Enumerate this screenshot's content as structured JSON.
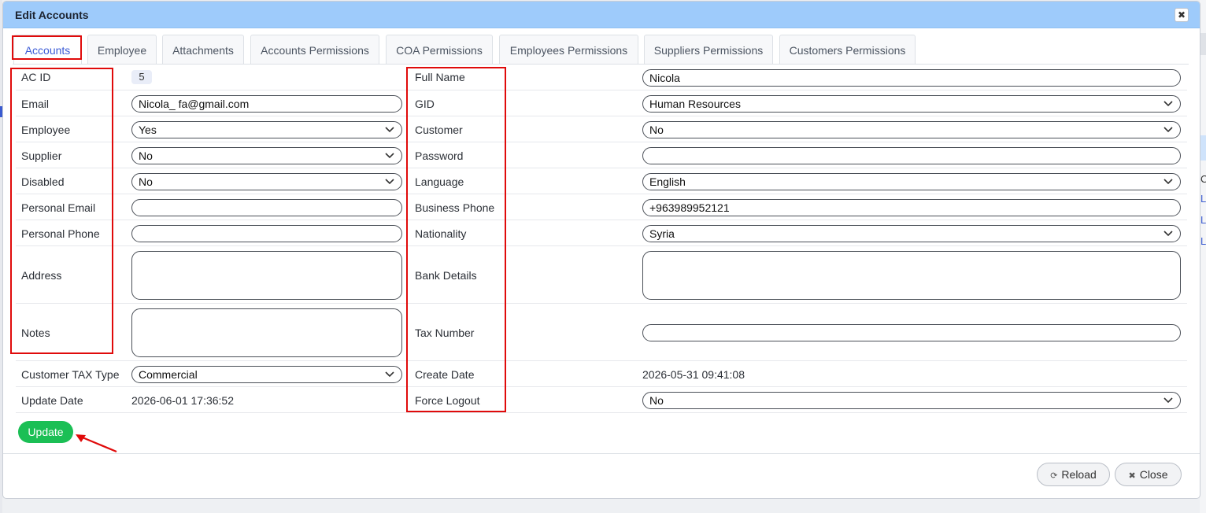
{
  "dialog": {
    "title": "Edit Accounts",
    "close_icon": "close-x-icon"
  },
  "tabs": [
    {
      "label": "Accounts",
      "active": true
    },
    {
      "label": "Employee"
    },
    {
      "label": "Attachments"
    },
    {
      "label": "Accounts Permissions"
    },
    {
      "label": "COA Permissions"
    },
    {
      "label": "Employees Permissions"
    },
    {
      "label": "Suppliers Permissions"
    },
    {
      "label": "Customers Permissions"
    }
  ],
  "form": {
    "left": {
      "ac_id": {
        "label": "AC ID",
        "value": "5"
      },
      "email": {
        "label": "Email",
        "value": "Nicola_ fa@gmail.com"
      },
      "employee": {
        "label": "Employee",
        "value": "Yes"
      },
      "supplier": {
        "label": "Supplier",
        "value": "No"
      },
      "disabled": {
        "label": "Disabled",
        "value": "No"
      },
      "personal_email": {
        "label": "Personal Email",
        "value": ""
      },
      "personal_phone": {
        "label": "Personal Phone",
        "value": ""
      },
      "address": {
        "label": "Address",
        "value": ""
      },
      "notes": {
        "label": "Notes",
        "value": ""
      },
      "customer_tax_type": {
        "label": "Customer TAX Type",
        "value": "Commercial"
      },
      "update_date": {
        "label": "Update Date",
        "value": "2026-06-01 17:36:52"
      }
    },
    "right": {
      "full_name": {
        "label": "Full Name",
        "value": "Nicola"
      },
      "gid": {
        "label": "GID",
        "value": "Human Resources"
      },
      "customer": {
        "label": "Customer",
        "value": "No"
      },
      "password": {
        "label": "Password",
        "value": ""
      },
      "language": {
        "label": "Language",
        "value": "English"
      },
      "business_phone": {
        "label": "Business Phone",
        "value": "+963989952121"
      },
      "nationality": {
        "label": "Nationality",
        "value": "Syria"
      },
      "bank_details": {
        "label": "Bank Details",
        "value": ""
      },
      "tax_number": {
        "label": "Tax Number",
        "value": ""
      },
      "create_date": {
        "label": "Create Date",
        "value": "2026-05-31 09:41:08"
      },
      "force_logout": {
        "label": "Force Logout",
        "value": "No"
      }
    }
  },
  "actions": {
    "update_label": "Update",
    "reload_label": "Reload",
    "close_label": "Close",
    "reload_icon": "refresh-icon",
    "close_icon": "close-x-icon"
  },
  "background": {
    "fragments": [
      "C",
      "L",
      "L",
      "L"
    ]
  },
  "colors": {
    "titlebar": "#9ecbfb",
    "active_tab_text": "#3b5bd6",
    "update_button": "#1bbf55",
    "annotation_red": "#e00a0a"
  }
}
